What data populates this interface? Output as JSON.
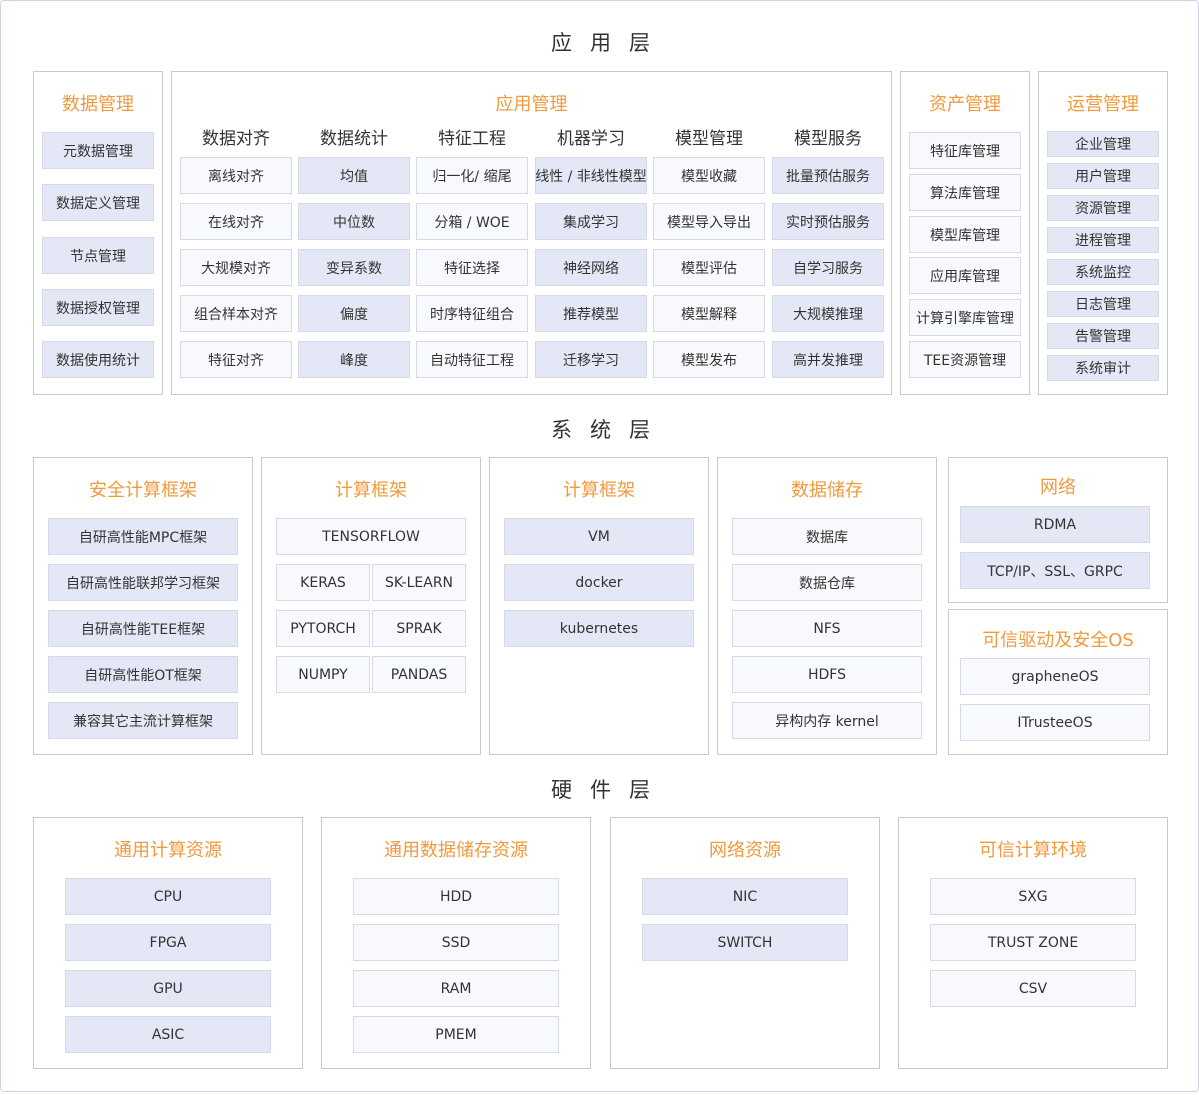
{
  "layers": {
    "application": "应用层",
    "system": "系统层",
    "hardware": "硬件层"
  },
  "app": {
    "data_mgmt": {
      "title": "数据管理",
      "items": [
        "元数据管理",
        "数据定义管理",
        "节点管理",
        "数据授权管理",
        "数据使用统计"
      ]
    },
    "app_mgmt": {
      "title": "应用管理",
      "columns": [
        {
          "header": "数据对齐",
          "items": [
            "离线对齐",
            "在线对齐",
            "大规模对齐",
            "组合样本对齐",
            "特征对齐"
          ]
        },
        {
          "header": "数据统计",
          "items": [
            "均值",
            "中位数",
            "变异系数",
            "偏度",
            "峰度"
          ]
        },
        {
          "header": "特征工程",
          "items": [
            "归一化/ 缩尾",
            "分箱 / WOE",
            "特征选择",
            "时序特征组合",
            "自动特征工程"
          ]
        },
        {
          "header": "机器学习",
          "items": [
            "线性 / 非线性模型",
            "集成学习",
            "神经网络",
            "推荐模型",
            "迁移学习"
          ]
        },
        {
          "header": "模型管理",
          "items": [
            "模型收藏",
            "模型导入导出",
            "模型评估",
            "模型解释",
            "模型发布"
          ]
        },
        {
          "header": "模型服务",
          "items": [
            "批量预估服务",
            "实时预估服务",
            "自学习服务",
            "大规模推理",
            "高并发推理"
          ]
        }
      ]
    },
    "asset_mgmt": {
      "title": "资产管理",
      "items": [
        "特征库管理",
        "算法库管理",
        "模型库管理",
        "应用库管理",
        "计算引擎库管理",
        "TEE资源管理"
      ]
    },
    "ops_mgmt": {
      "title": "运营管理",
      "items": [
        "企业管理",
        "用户管理",
        "资源管理",
        "进程管理",
        "系统监控",
        "日志管理",
        "告警管理",
        "系统审计"
      ]
    }
  },
  "sys": {
    "secure_compute": {
      "title": "安全计算框架",
      "items": [
        "自研高性能MPC框架",
        "自研高性能联邦学习框架",
        "自研高性能TEE框架",
        "自研高性能OT框架",
        "兼容其它主流计算框架"
      ]
    },
    "compute_fw1": {
      "title": "计算框架",
      "top": "TENSORFLOW",
      "grid": [
        "KERAS",
        "SK-LEARN",
        "PYTORCH",
        "SPRAK",
        "NUMPY",
        "PANDAS"
      ]
    },
    "compute_fw2": {
      "title": "计算框架",
      "items": [
        "VM",
        "docker",
        "kubernetes"
      ]
    },
    "storage": {
      "title": "数据储存",
      "items": [
        "数据库",
        "数据仓库",
        "NFS",
        "HDFS",
        "异构内存 kernel"
      ]
    },
    "network": {
      "title": "网络",
      "items": [
        "RDMA",
        "TCP/IP、SSL、GRPC"
      ]
    },
    "trusted_os": {
      "title": "可信驱动及安全OS",
      "items": [
        "grapheneOS",
        "ITrusteeOS"
      ]
    }
  },
  "hw": {
    "compute": {
      "title": "通用计算资源",
      "items": [
        "CPU",
        "FPGA",
        "GPU",
        "ASIC"
      ]
    },
    "storage": {
      "title": "通用数据储存资源",
      "items": [
        "HDD",
        "SSD",
        "RAM",
        "PMEM"
      ]
    },
    "network": {
      "title": "网络资源",
      "items": [
        "NIC",
        "SWITCH"
      ]
    },
    "trusted": {
      "title": "可信计算环境",
      "items": [
        "SXG",
        "TRUST ZONE",
        "CSV"
      ]
    }
  }
}
